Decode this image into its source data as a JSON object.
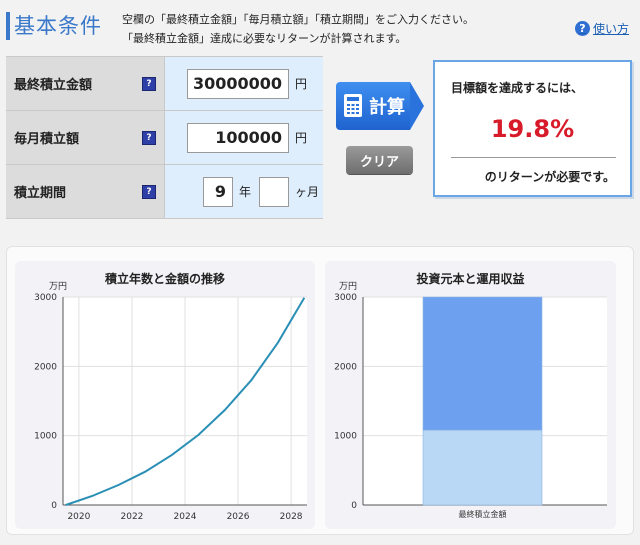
{
  "header": {
    "title": "基本条件",
    "instruction_line1": "空欄の「最終積立金額」「毎月積立額」「積立期間」をご入力ください。",
    "instruction_line2": "「最終積立金額」達成に必要なリターンが計算されます。",
    "help_label": "使い方",
    "help_icon_char": "?"
  },
  "form": {
    "final_amount": {
      "label": "最終積立金額",
      "value": "30000000",
      "unit": "円"
    },
    "monthly": {
      "label": "毎月積立額",
      "value": "100000",
      "unit": "円"
    },
    "period": {
      "label": "積立期間",
      "years": "9",
      "year_unit": "年",
      "months": "",
      "month_unit": "ヶ月"
    },
    "help_char": "?"
  },
  "buttons": {
    "calc_label": "計算",
    "clear_label": "クリア"
  },
  "result": {
    "line1": "目標額を達成するには、",
    "rate": "19.8%",
    "line2": "のリターンが必要です。"
  },
  "colors": {
    "accent": "#3a78c9",
    "rate_red": "#d81b2a",
    "line": "#2a8fb5",
    "bar_top": "#6ea0f0",
    "bar_bottom": "#b9d8f5"
  },
  "chart_data": [
    {
      "type": "line",
      "title": "積立年数と金額の推移",
      "ylabel": "万円",
      "ylim": [
        0,
        3000
      ],
      "yticks": [
        0,
        1000,
        2000,
        3000
      ],
      "xlim": [
        2019.4,
        2028.6
      ],
      "xticks": [
        2020,
        2022,
        2024,
        2026,
        2028
      ],
      "x": [
        2019.5,
        2020.5,
        2021.5,
        2022.5,
        2023.5,
        2024.5,
        2025.5,
        2026.5,
        2027.5,
        2028.5
      ],
      "values": [
        0,
        130,
        290,
        480,
        720,
        1010,
        1370,
        1800,
        2340,
        2990
      ]
    },
    {
      "type": "bar",
      "title": "投資元本と運用収益",
      "ylabel": "万円",
      "ylim": [
        0,
        3000
      ],
      "yticks": [
        0,
        1000,
        2000,
        3000
      ],
      "categories": [
        "最終積立金額"
      ],
      "series": [
        {
          "values": [
            1080
          ]
        },
        {
          "values": [
            1920
          ]
        }
      ]
    }
  ]
}
